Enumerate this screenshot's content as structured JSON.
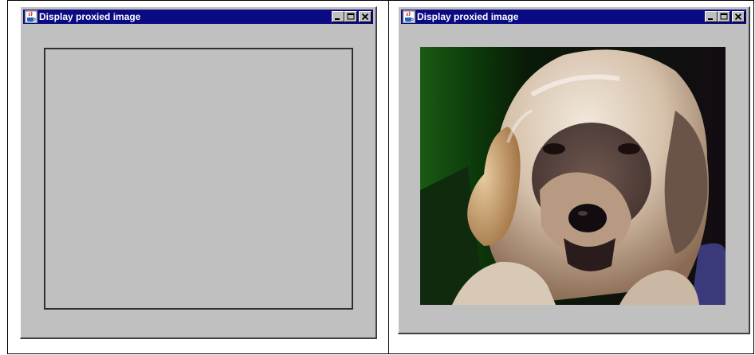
{
  "windows": [
    {
      "title": "Display proxied image",
      "icon": "java-cup-icon",
      "controls": [
        "minimize",
        "maximize",
        "close"
      ],
      "content": "empty-placeholder"
    },
    {
      "title": "Display proxied image",
      "icon": "java-cup-icon",
      "controls": [
        "minimize",
        "maximize",
        "close"
      ],
      "content": "loaded-image"
    }
  ],
  "colors": {
    "titlebar": "#0a0a84",
    "window_face": "#c0c0c0",
    "title_text": "#ffffff"
  }
}
